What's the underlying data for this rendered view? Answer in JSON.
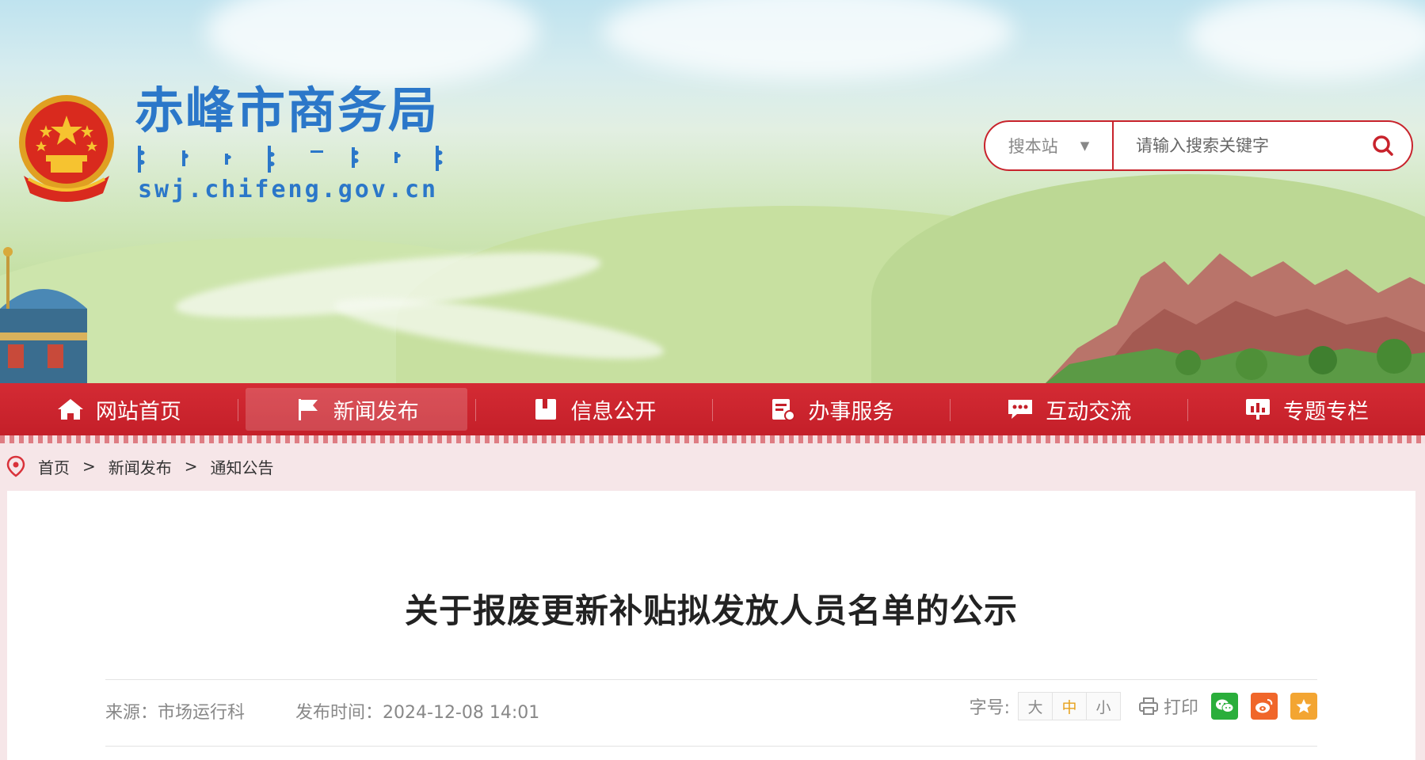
{
  "site": {
    "title": "赤峰市商务局",
    "domain": "swj.chifeng.gov.cn"
  },
  "search": {
    "scope_label": "搜本站",
    "placeholder": "请输入搜索关键字"
  },
  "nav": {
    "items": [
      {
        "label": "网站首页",
        "icon": "home-icon"
      },
      {
        "label": "新闻发布",
        "icon": "flag-icon",
        "active": true
      },
      {
        "label": "信息公开",
        "icon": "book-icon"
      },
      {
        "label": "办事服务",
        "icon": "document-icon"
      },
      {
        "label": "互动交流",
        "icon": "chat-icon"
      },
      {
        "label": "专题专栏",
        "icon": "presentation-icon"
      }
    ]
  },
  "breadcrumb": {
    "items": [
      "首页",
      "新闻发布",
      "通知公告"
    ],
    "separator": ">"
  },
  "article": {
    "title": "关于报废更新补贴拟发放人员名单的公示",
    "source": "来源：市场运行科",
    "publish_time": "发布时间：2024-12-08 14:01"
  },
  "tools": {
    "font_size_label": "字号:",
    "font_sizes": [
      "大",
      "中",
      "小"
    ],
    "font_size_active": "中",
    "print_label": "打印",
    "share": [
      "wechat-icon",
      "weibo-icon",
      "favorite-icon"
    ]
  },
  "colors": {
    "brand_red": "#c8232c",
    "title_blue": "#2b77c9",
    "wechat_green": "#2aae3b",
    "weibo_orange": "#f0662a",
    "favorite_orange": "#f3a532"
  }
}
